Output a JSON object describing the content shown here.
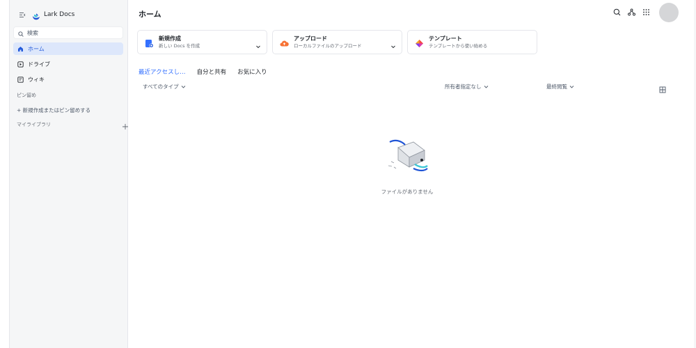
{
  "app": {
    "name": "Lark Docs"
  },
  "sidebar": {
    "search_placeholder": "検索",
    "items": [
      {
        "label": "ホーム",
        "active": true
      },
      {
        "label": "ドライブ",
        "active": false
      },
      {
        "label": "ウィキ",
        "active": false
      }
    ],
    "pins_label": "ピン留め",
    "pin_action": "+ 新規作成またはピン留めする",
    "library_label": "マイライブラリ"
  },
  "main": {
    "title": "ホーム",
    "cards": [
      {
        "title": "新規作成",
        "subtitle": "新しい Docs を作成"
      },
      {
        "title": "アップロード",
        "subtitle": "ローカルファイルのアップロード"
      },
      {
        "title": "テンプレート",
        "subtitle": "テンプレートから使い始める"
      }
    ],
    "tabs": [
      {
        "label": "最近アクセスし…",
        "active": true
      },
      {
        "label": "自分と共有",
        "active": false
      },
      {
        "label": "お気に入り",
        "active": false
      }
    ],
    "filters": {
      "type": "すべてのタイプ",
      "owner": "所有者指定なし",
      "sort": "最終閲覧"
    },
    "empty_text": "ファイルがありません"
  },
  "colors": {
    "accent": "#3370ff",
    "sidebar_bg": "#f5f6f7",
    "active_bg": "#dde7fb"
  }
}
